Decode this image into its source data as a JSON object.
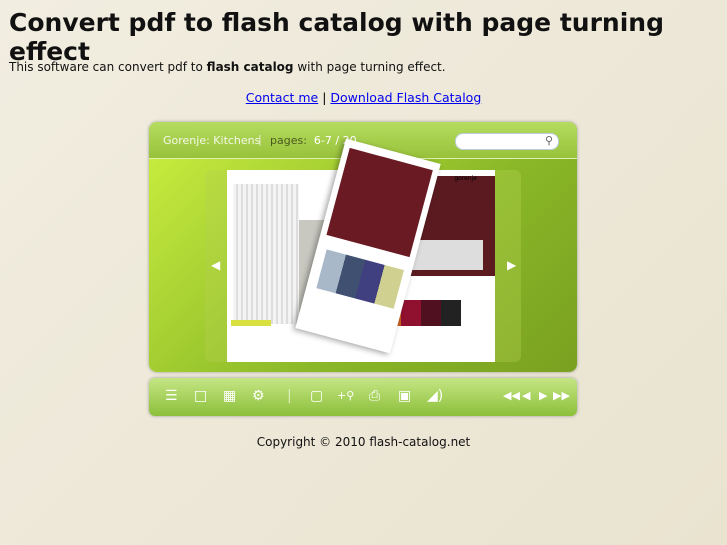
{
  "title": "Convert pdf to flash catalog with page turning effect",
  "intro": {
    "before": "This software can convert pdf to ",
    "bold": "flash catalog",
    "after": " with page turning effect."
  },
  "links": {
    "contact": "Contact me",
    "sep": "|",
    "download": "Download Flash Catalog"
  },
  "viewer": {
    "book_title": "Gorenje: Kitchens",
    "sep": "|",
    "pages_label": "pages:",
    "pages_value": "6-7 / 20",
    "brand": "gorenje"
  },
  "toolbar": {
    "icons": [
      "table-of-contents-icon",
      "bookmark-icon",
      "thumbnails-icon",
      "share-icon",
      "fullscreen-icon",
      "zoom-in-icon",
      "print-icon",
      "save-icon",
      "sound-icon",
      "first-page-icon",
      "previous-page-icon",
      "next-page-icon",
      "last-page-icon"
    ]
  },
  "copyright": "Copyright © 2010 flash-catalog.net",
  "colors": {
    "accent": "#98c23a",
    "link": "#0000ee"
  }
}
